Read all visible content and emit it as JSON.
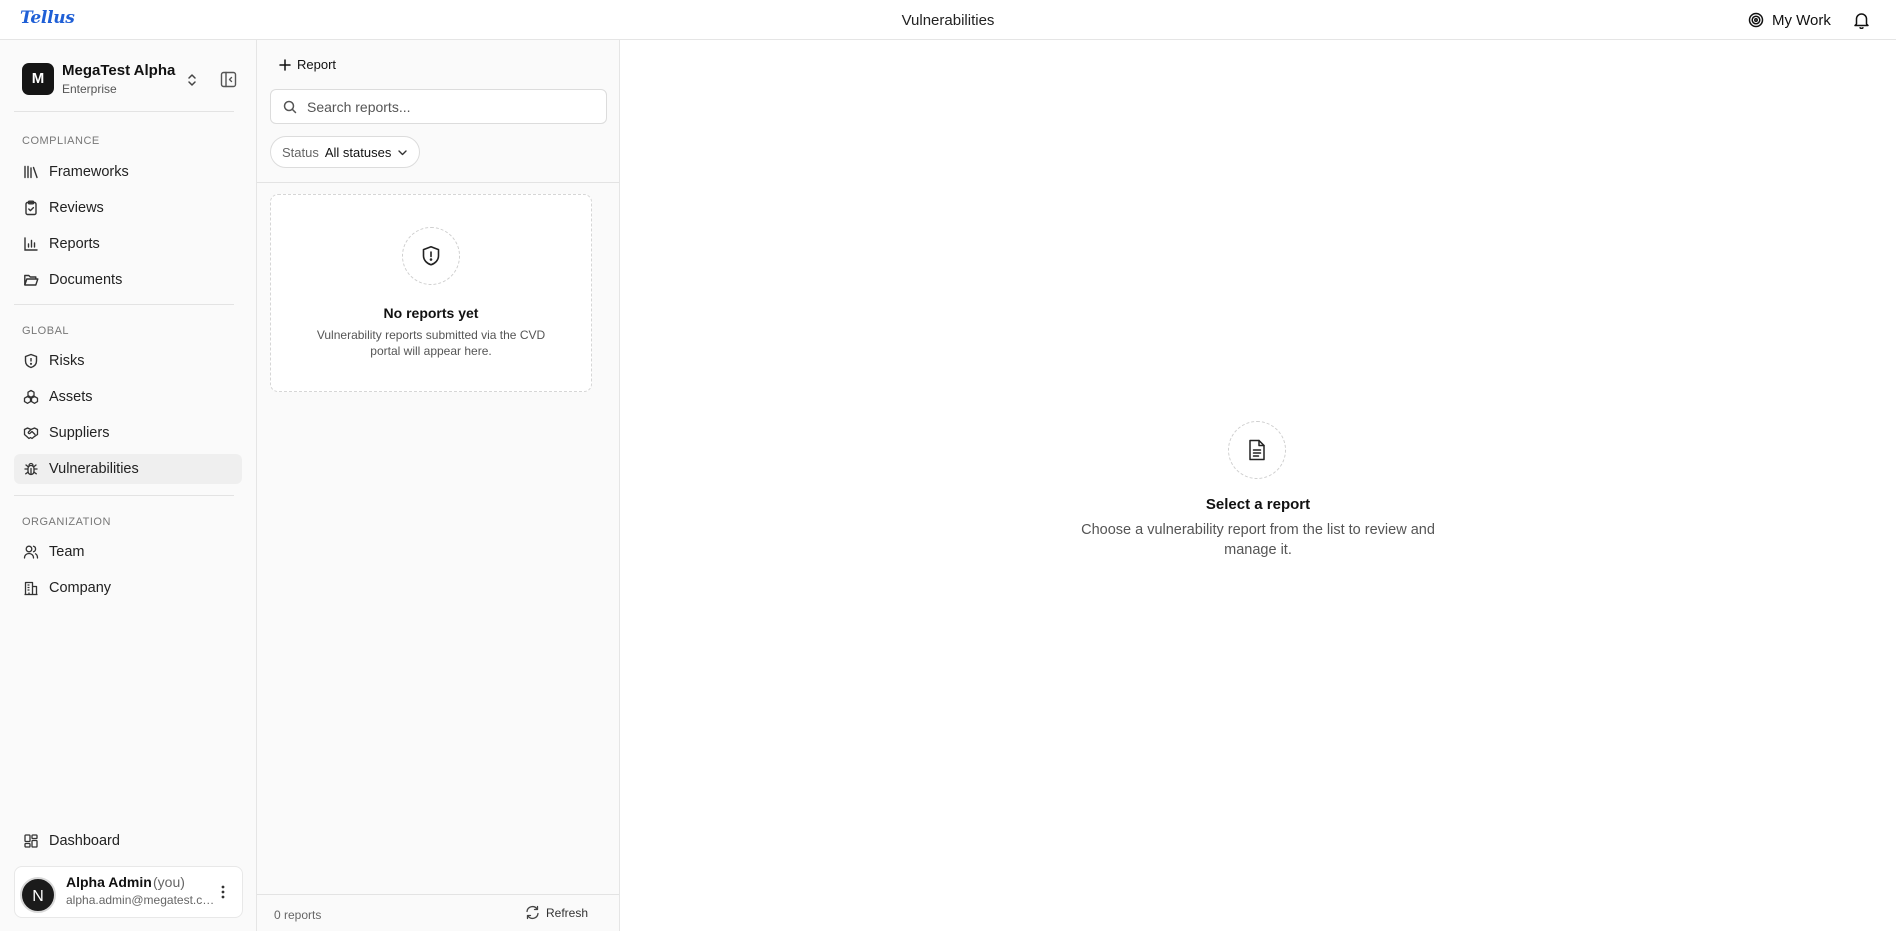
{
  "topbar": {
    "logo": "Tellus",
    "title": "Vulnerabilities",
    "my_work_label": "My Work"
  },
  "sidebar": {
    "org": {
      "initial": "M",
      "name": "MegaTest Alpha",
      "plan": "Enterprise"
    },
    "sections": {
      "compliance": "COMPLIANCE",
      "global": "GLOBAL",
      "organization": "ORGANIZATION"
    },
    "items": {
      "frameworks": "Frameworks",
      "reviews": "Reviews",
      "reports": "Reports",
      "documents": "Documents",
      "risks": "Risks",
      "assets": "Assets",
      "suppliers": "Suppliers",
      "vulnerabilities": "Vulnerabilities",
      "team": "Team",
      "company": "Company",
      "dashboard": "Dashboard"
    },
    "active_item": "Vulnerabilities",
    "user": {
      "initial": "N",
      "name": "Alpha Admin",
      "you_tag": "(you)",
      "email": "alpha.admin@megatest.com"
    }
  },
  "list_panel": {
    "add_report_label": "Report",
    "search": {
      "placeholder": "Search reports...",
      "value": ""
    },
    "status_filter": {
      "label": "Status",
      "value": "All statuses"
    },
    "empty_state": {
      "title": "No reports yet",
      "description": "Vulnerability reports submitted via the CVD portal will appear here."
    },
    "footer": {
      "count": "0 reports",
      "refresh_label": "Refresh"
    }
  },
  "detail": {
    "title": "Select a report",
    "description": "Choose a vulnerability report from the list to review and manage it."
  },
  "colors": {
    "brand": "#1f5fd6",
    "active_nav_bg": "#efefef",
    "panel_bg": "#fafafa"
  }
}
